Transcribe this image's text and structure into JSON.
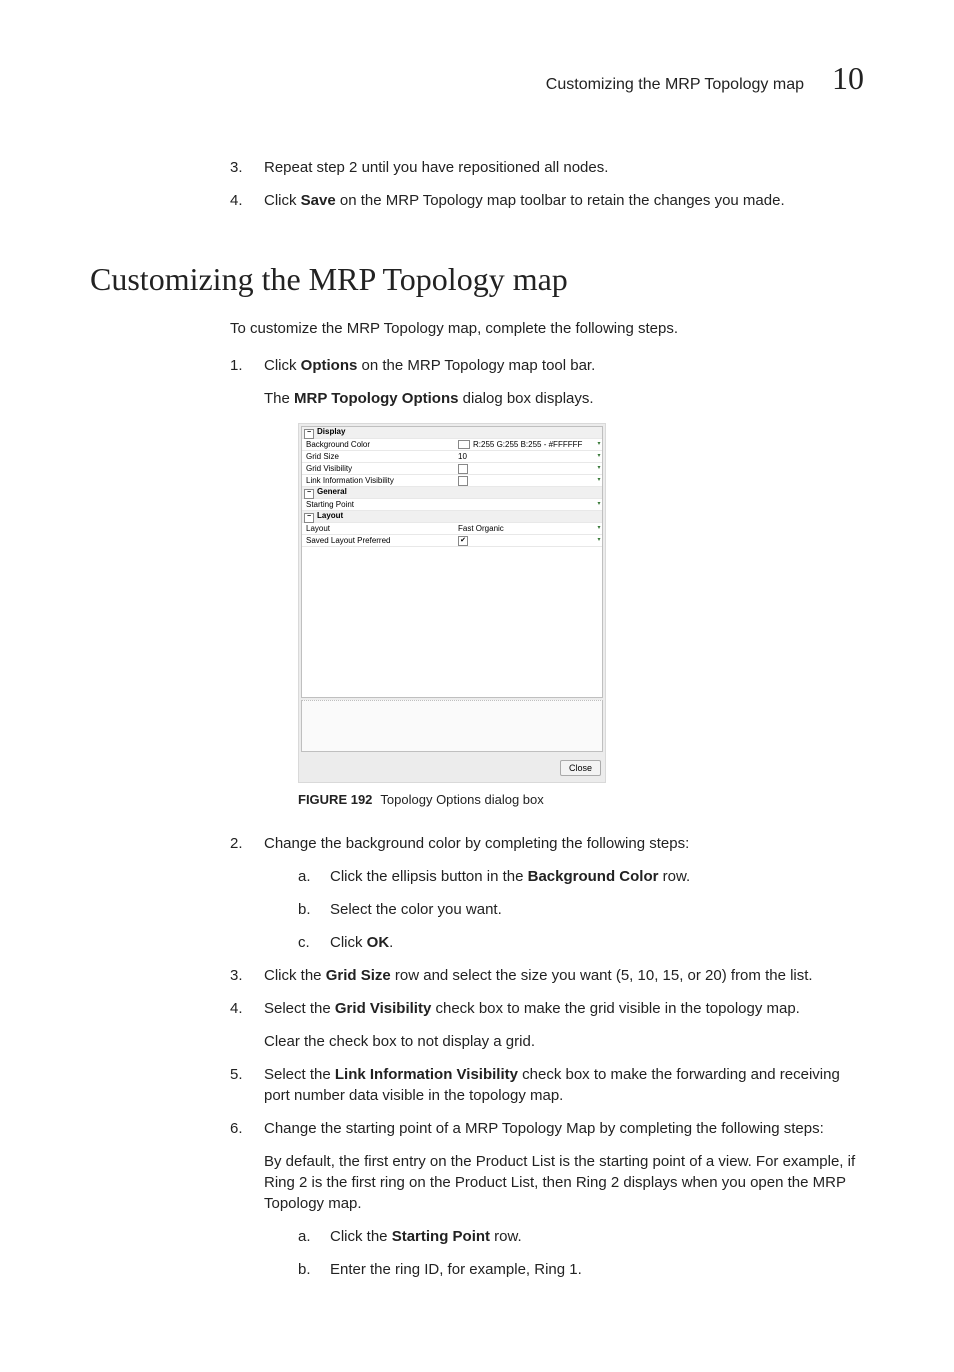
{
  "header": {
    "title": "Customizing the MRP Topology map",
    "chapter_number": "10"
  },
  "top_steps": {
    "s3": "Repeat step 2 until you have repositioned all nodes.",
    "s4_pre": "Click ",
    "s4_b": "Save",
    "s4_post": " on the MRP Topology map toolbar to retain the changes you made."
  },
  "section_heading": "Customizing the MRP Topology map",
  "intro": "To customize the MRP Topology map, complete the following steps.",
  "step1": {
    "pre": "Click ",
    "b": "Options",
    "post": " on the MRP Topology map tool bar.",
    "result_pre": "The ",
    "result_b": "MRP Topology Options",
    "result_post": " dialog box displays."
  },
  "dialog": {
    "groups": {
      "display": "Display",
      "general": "General",
      "layout": "Layout"
    },
    "rows": {
      "bg_label": "Background Color",
      "bg_value": "R:255 G:255 B:255 - #FFFFFF",
      "grid_size_label": "Grid Size",
      "grid_size_value": "10",
      "grid_vis_label": "Grid Visibility",
      "link_vis_label": "Link Information Visibility",
      "start_label": "Starting Point",
      "start_value": "",
      "layout_label": "Layout",
      "layout_value": "Fast Organic",
      "saved_label": "Saved Layout Preferred"
    },
    "close": "Close"
  },
  "figure": {
    "label": "FIGURE 192",
    "caption": "Topology Options dialog box"
  },
  "step2": {
    "lead": "Change the background color by completing the following steps:",
    "a_pre": "Click the ellipsis button in the ",
    "a_b": "Background Color",
    "a_post": " row.",
    "b": "Select the color you want.",
    "c_pre": "Click ",
    "c_b": "OK",
    "c_post": "."
  },
  "step3": {
    "pre": "Click the ",
    "b": "Grid Size",
    "post": " row and select the size you want (5, 10, 15, or 20) from the list."
  },
  "step4": {
    "pre": "Select the ",
    "b": "Grid Visibility",
    "post": " check box to make the grid visible in the topology map.",
    "clear": "Clear the check box to not display a grid."
  },
  "step5": {
    "pre": "Select the ",
    "b": "Link Information Visibility",
    "post": " check box to make the forwarding and receiving port number data visible in the topology map."
  },
  "step6": {
    "lead": "Change the starting point of a MRP Topology Map by completing the following steps:",
    "default_para": "By default, the first entry on the Product List is the starting point of a view. For example, if Ring 2 is the first ring on the Product List, then Ring 2 displays when you open the MRP Topology map.",
    "a_pre": "Click the ",
    "a_b": "Starting Point",
    "a_post": " row.",
    "b": "Enter the ring ID, for example, Ring 1."
  }
}
